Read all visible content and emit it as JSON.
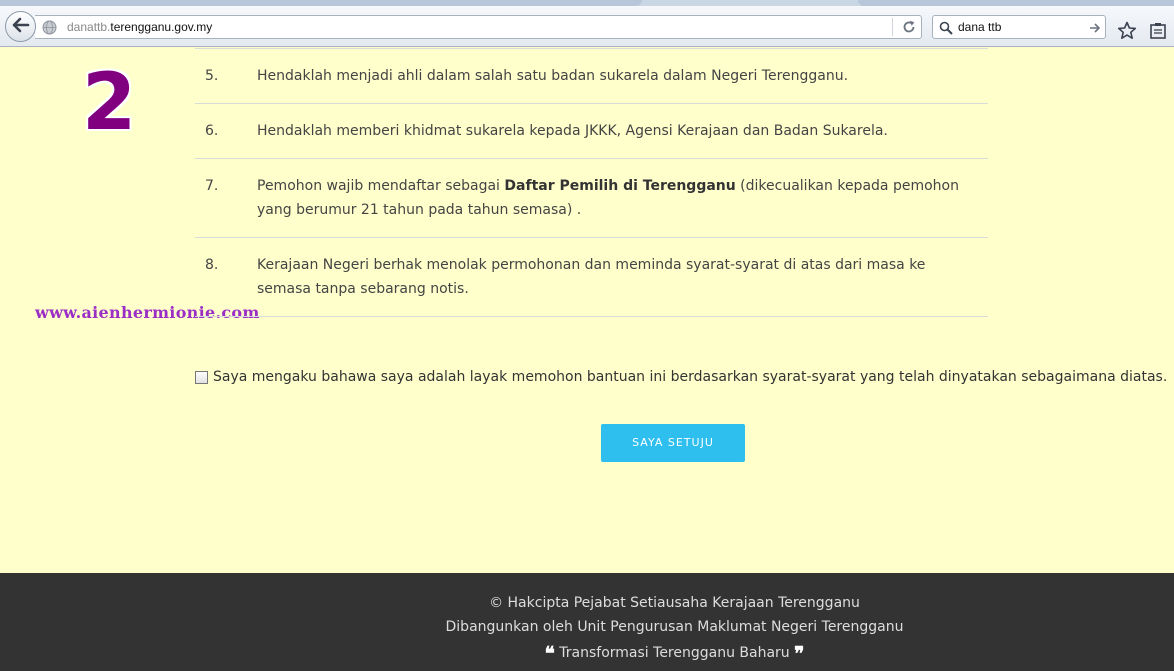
{
  "browser": {
    "url_prefix": "danattb.",
    "url_domain": "terengganu.gov.my",
    "search_query": "dana ttb"
  },
  "watermark": {
    "number": "2",
    "site": "www.aienhermionie.com"
  },
  "requirements": [
    {
      "num": "5.",
      "text": "Hendaklah menjadi ahli dalam salah satu badan sukarela dalam Negeri Terengganu."
    },
    {
      "num": "6.",
      "text": "Hendaklah memberi khidmat sukarela kepada JKKK, Agensi Kerajaan dan Badan Sukarela."
    },
    {
      "num": "7.",
      "text_before": "Pemohon wajib mendaftar sebagai ",
      "text_bold": "Daftar Pemilih di Terengganu",
      "text_after": " (dikecualikan kepada pemohon yang berumur 21 tahun pada tahun semasa) ."
    },
    {
      "num": "8.",
      "text": "Kerajaan Negeri berhak menolak permohonan dan meminda syarat-syarat di atas dari masa ke semasa tanpa sebarang notis."
    }
  ],
  "agreement": {
    "checkbox_label": "Saya mengaku bahawa saya adalah layak memohon bantuan ini berdasarkan syarat-syarat yang telah dinyatakan sebagaimana diatas.",
    "checked": false,
    "button_label": "SAYA SETUJU"
  },
  "footer": {
    "copyright_symbol": "©",
    "copyright": "Hakcipta Pejabat Setiausaha Kerajaan Terengganu",
    "developer": "Dibangunkan oleh Unit Pengurusan Maklumat Negeri Terengganu",
    "quote_open": "❝",
    "slogan": "Transformasi Terengganu Baharu",
    "quote_close": "❞"
  },
  "colors": {
    "page_background": "#ffffcc",
    "button": "#2fbfef",
    "footer": "#333333",
    "watermark_number": "#800080",
    "watermark_url": "#9b2ec4"
  }
}
